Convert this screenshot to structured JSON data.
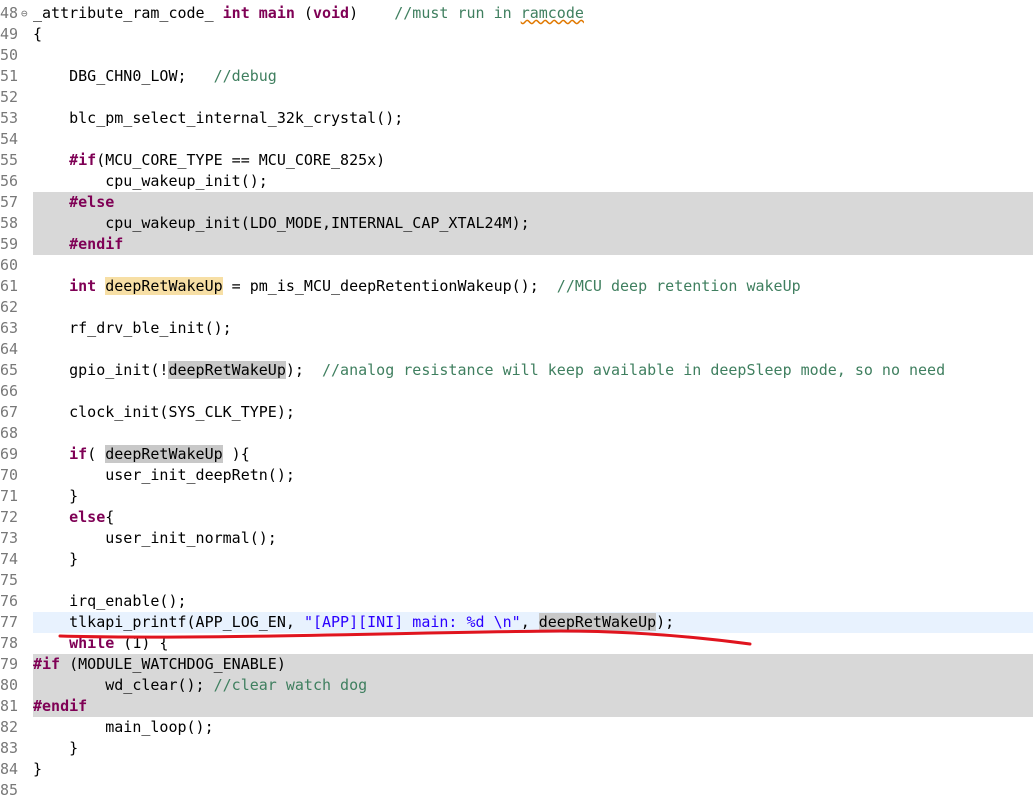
{
  "lines": [
    {
      "n": "48",
      "fold": "⊖",
      "t": [
        [
          "_attribute_ram_code_ ",
          ""
        ],
        [
          "int",
          "kw"
        ],
        [
          " ",
          ""
        ],
        [
          "main",
          "kw"
        ],
        [
          " (",
          ""
        ],
        [
          "void",
          "kw"
        ],
        [
          ")    ",
          ""
        ],
        [
          "//must run in ",
          "cm"
        ],
        [
          "ramcode",
          "cm sq"
        ]
      ]
    },
    {
      "n": "49",
      "t": [
        [
          "{",
          ""
        ]
      ]
    },
    {
      "n": "50",
      "t": []
    },
    {
      "n": "51",
      "t": [
        [
          "    DBG_CHN0_LOW;   ",
          ""
        ],
        [
          "//debug",
          "cm"
        ]
      ]
    },
    {
      "n": "52",
      "t": []
    },
    {
      "n": "53",
      "t": [
        [
          "    blc_pm_select_internal_32k_crystal();",
          ""
        ]
      ]
    },
    {
      "n": "54",
      "t": []
    },
    {
      "n": "55",
      "t": [
        [
          "    ",
          ""
        ],
        [
          "#if",
          "pp"
        ],
        [
          "(MCU_CORE_TYPE == MCU_CORE_825x)",
          ""
        ]
      ]
    },
    {
      "n": "56",
      "t": [
        [
          "        cpu_wakeup_init();",
          ""
        ]
      ]
    },
    {
      "n": "57",
      "shade": true,
      "t": [
        [
          "    ",
          ""
        ],
        [
          "#else",
          "pp"
        ]
      ]
    },
    {
      "n": "58",
      "shade": true,
      "t": [
        [
          "        cpu_wakeup_init(LDO_MODE,INTERNAL_CAP_XTAL24M);",
          ""
        ]
      ]
    },
    {
      "n": "59",
      "shade": true,
      "t": [
        [
          "    ",
          ""
        ],
        [
          "#endif",
          "pp"
        ]
      ]
    },
    {
      "n": "60",
      "t": []
    },
    {
      "n": "61",
      "t": [
        [
          "    ",
          ""
        ],
        [
          "int",
          "kw"
        ],
        [
          " ",
          ""
        ],
        [
          "deepRetWakeUp",
          "hlw"
        ],
        [
          " = pm_is_MCU_deepRetentionWakeup();  ",
          ""
        ],
        [
          "//MCU deep retention wakeUp",
          "cm"
        ]
      ]
    },
    {
      "n": "62",
      "t": []
    },
    {
      "n": "63",
      "t": [
        [
          "    rf_drv_ble_init();",
          ""
        ]
      ]
    },
    {
      "n": "64",
      "t": []
    },
    {
      "n": "65",
      "t": [
        [
          "    gpio_init(!",
          ""
        ],
        [
          "deepRetWakeUp",
          "hl"
        ],
        [
          ");  ",
          ""
        ],
        [
          "//analog resistance will keep available in deepSleep mode, so no need",
          "cm"
        ]
      ]
    },
    {
      "n": "66",
      "t": []
    },
    {
      "n": "67",
      "t": [
        [
          "    clock_init(SYS_CLK_TYPE);",
          ""
        ]
      ]
    },
    {
      "n": "68",
      "t": []
    },
    {
      "n": "69",
      "t": [
        [
          "    ",
          ""
        ],
        [
          "if",
          "kw"
        ],
        [
          "( ",
          ""
        ],
        [
          "deepRetWakeUp",
          "hl"
        ],
        [
          " ){",
          ""
        ]
      ]
    },
    {
      "n": "70",
      "t": [
        [
          "        user_init_deepRetn();",
          ""
        ]
      ]
    },
    {
      "n": "71",
      "t": [
        [
          "    }",
          ""
        ]
      ]
    },
    {
      "n": "72",
      "t": [
        [
          "    ",
          ""
        ],
        [
          "else",
          "kw"
        ],
        [
          "{",
          ""
        ]
      ]
    },
    {
      "n": "73",
      "t": [
        [
          "        user_init_normal();",
          ""
        ]
      ]
    },
    {
      "n": "74",
      "t": [
        [
          "    }",
          ""
        ]
      ]
    },
    {
      "n": "75",
      "t": []
    },
    {
      "n": "76",
      "t": [
        [
          "    irq_enable();",
          ""
        ]
      ]
    },
    {
      "n": "77",
      "current": true,
      "t": [
        [
          "    tlkapi_printf(APP_LOG_EN, ",
          ""
        ],
        [
          "\"[APP][INI] main: %d \\n\"",
          "st"
        ],
        [
          ", ",
          ""
        ],
        [
          "deepRetWakeUp",
          "hl"
        ],
        [
          ");",
          ""
        ]
      ]
    },
    {
      "n": "78",
      "t": [
        [
          "    ",
          ""
        ],
        [
          "while",
          "kw"
        ],
        [
          " (1) {",
          ""
        ]
      ]
    },
    {
      "n": "79",
      "shade": true,
      "t": [
        [
          "#if",
          "pp"
        ],
        [
          " (MODULE_WATCHDOG_ENABLE)",
          ""
        ]
      ]
    },
    {
      "n": "80",
      "shade": true,
      "t": [
        [
          "        wd_clear(); ",
          ""
        ],
        [
          "//clear watch dog",
          "cm"
        ]
      ]
    },
    {
      "n": "81",
      "shade": true,
      "t": [
        [
          "#endif",
          "pp"
        ]
      ]
    },
    {
      "n": "82",
      "t": [
        [
          "        main_loop();",
          ""
        ]
      ]
    },
    {
      "n": "83",
      "t": [
        [
          "    }",
          ""
        ]
      ]
    },
    {
      "n": "84",
      "t": [
        [
          "}",
          ""
        ]
      ]
    },
    {
      "n": "85",
      "t": []
    }
  ],
  "colors": {
    "annotation": "#e0141e"
  }
}
